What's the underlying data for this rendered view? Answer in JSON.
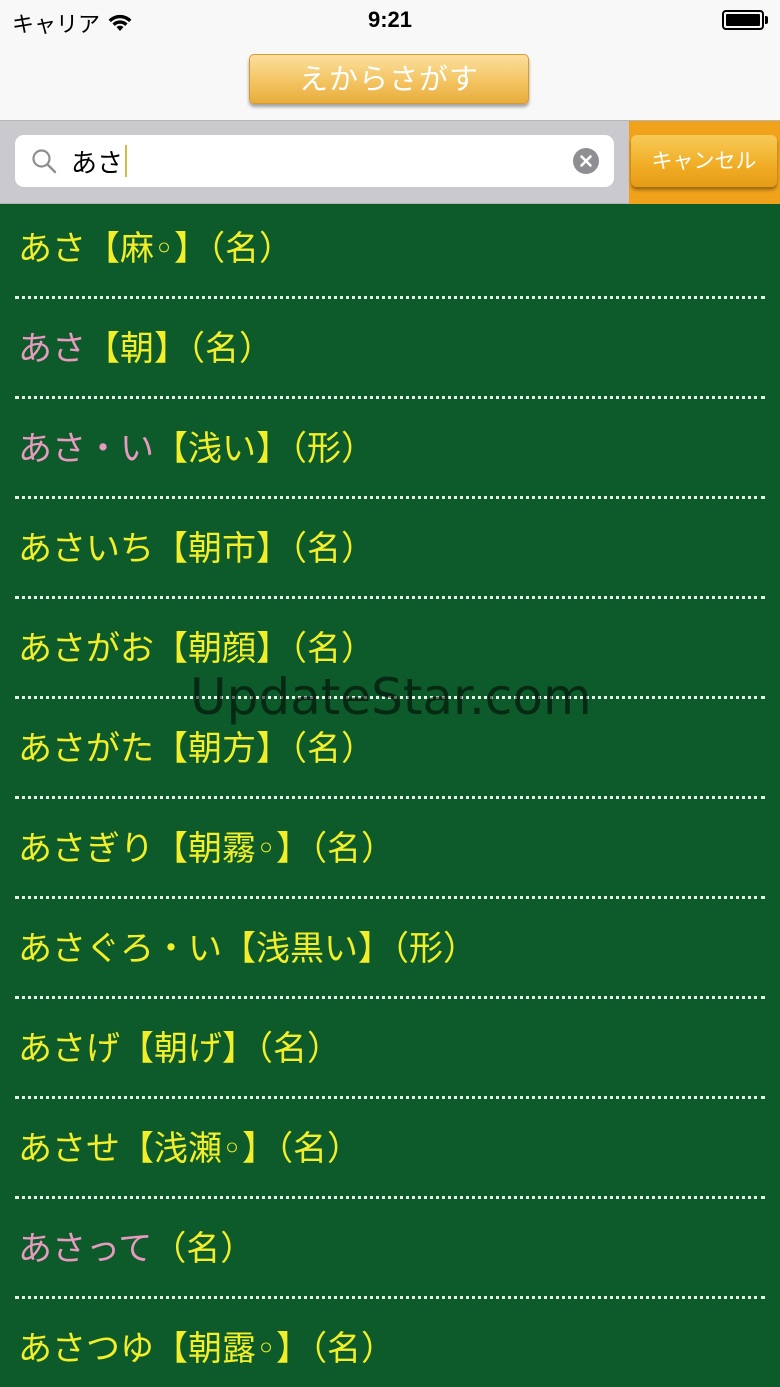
{
  "status_bar": {
    "carrier": "キャリア",
    "time": "9:21"
  },
  "navbar": {
    "title": "えからさがす"
  },
  "search": {
    "value": "あさ",
    "cancel_label": "キャンセル"
  },
  "entries": [
    {
      "reading": "あさ",
      "kanji": "【麻◦】",
      "pos": "（名）",
      "accent": "yellow"
    },
    {
      "reading": "あさ",
      "kanji": "【朝】",
      "pos": "（名）",
      "accent": "pink"
    },
    {
      "reading": "あさ・い",
      "kanji": "【浅い】",
      "pos": "（形）",
      "accent": "pink"
    },
    {
      "reading": "あさいち",
      "kanji": "【朝市】",
      "pos": "（名）",
      "accent": "yellow"
    },
    {
      "reading": "あさがお",
      "kanji": "【朝顔】",
      "pos": "（名）",
      "accent": "yellow"
    },
    {
      "reading": "あさがた",
      "kanji": "【朝方】",
      "pos": "（名）",
      "accent": "yellow"
    },
    {
      "reading": "あさぎり",
      "kanji": "【朝霧◦】",
      "pos": "（名）",
      "accent": "yellow"
    },
    {
      "reading": "あさぐろ・い",
      "kanji": "【浅黒い】",
      "pos": "（形）",
      "accent": "yellow"
    },
    {
      "reading": "あさげ",
      "kanji": "【朝げ】",
      "pos": "（名）",
      "accent": "yellow"
    },
    {
      "reading": "あさせ",
      "kanji": "【浅瀬◦】",
      "pos": "（名）",
      "accent": "yellow"
    },
    {
      "reading": "あさって",
      "kanji": "",
      "pos": "（名）",
      "accent": "pink"
    },
    {
      "reading": "あさつゆ",
      "kanji": "【朝露◦】",
      "pos": "（名）",
      "accent": "yellow"
    }
  ],
  "watermark": "UpdateStar.com",
  "colors": {
    "list_bg": "#0d5b2a",
    "text_yellow": "#f2ef2a",
    "text_pink": "#e89ac0",
    "accent_orange": "#f0a21b"
  }
}
